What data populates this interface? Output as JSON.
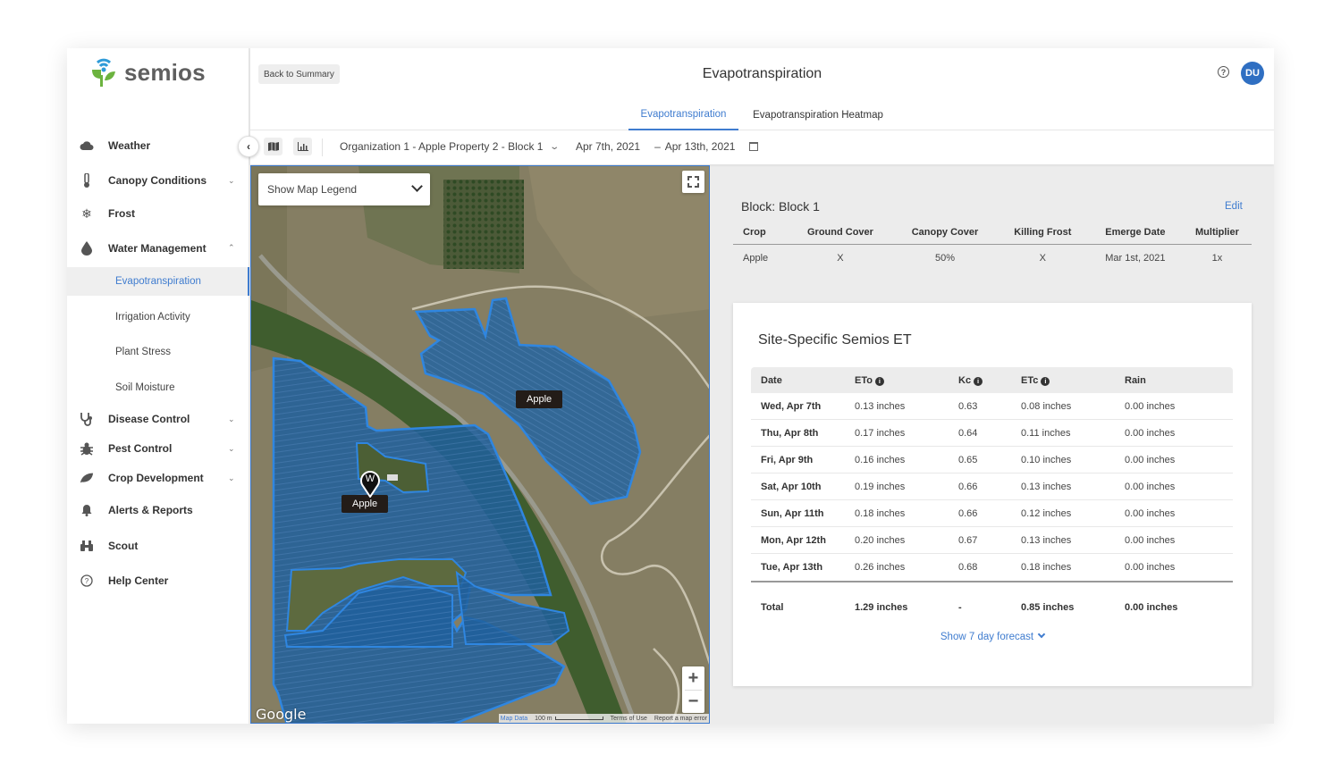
{
  "app": {
    "brand": "semios",
    "title": "Evapotranspiration",
    "back_label": "Back to Summary",
    "user_initials": "DU",
    "accent_color": "#3f7ccf"
  },
  "sidebar": {
    "items": [
      {
        "label": "Weather",
        "icon": "cloud-icon"
      },
      {
        "label": "Canopy Conditions",
        "icon": "thermometer-icon",
        "expandable": true
      },
      {
        "label": "Frost",
        "icon": "snowflake-icon"
      },
      {
        "label": "Water Management",
        "icon": "water-drop-icon",
        "expanded": true
      },
      {
        "label": "Disease Control",
        "icon": "stethoscope-icon",
        "expandable": true
      },
      {
        "label": "Pest Control",
        "icon": "bug-icon",
        "expandable": true
      },
      {
        "label": "Crop Development",
        "icon": "leaf-icon",
        "expandable": true
      },
      {
        "label": "Alerts & Reports",
        "icon": "bell-icon"
      },
      {
        "label": "Scout",
        "icon": "binoculars-icon"
      },
      {
        "label": "Help Center",
        "icon": "help-circle-icon"
      }
    ],
    "water_subitems": [
      {
        "label": "Evapotranspiration",
        "active": true
      },
      {
        "label": "Irrigation Activity"
      },
      {
        "label": "Plant Stress"
      },
      {
        "label": "Soil Moisture"
      }
    ]
  },
  "tabs": [
    {
      "label": "Evapotranspiration",
      "active": true
    },
    {
      "label": "Evapotranspiration Heatmap"
    }
  ],
  "toolbar": {
    "location": "Organization 1 - Apple Property 2 - Block 1",
    "date_start": "Apr 7th, 2021",
    "date_separator": "–",
    "date_end": "Apr 13th, 2021"
  },
  "map": {
    "legend_label": "Show Map Legend",
    "block_labels": [
      "Apple",
      "Apple"
    ],
    "pin_letter": "W",
    "attribution": {
      "logo": "Google",
      "map_data": "Map Data",
      "scale": "100 m",
      "terms": "Terms of Use",
      "report": "Report a map error"
    }
  },
  "block": {
    "title": "Block: Block 1",
    "edit_label": "Edit",
    "columns": [
      "Crop",
      "Ground Cover",
      "Canopy Cover",
      "Killing Frost",
      "Emerge Date",
      "Multiplier"
    ],
    "row": [
      "Apple",
      "X",
      "50%",
      "X",
      "Mar 1st, 2021",
      "1x"
    ]
  },
  "et": {
    "title": "Site-Specific Semios ET",
    "columns": [
      "Date",
      "ETo",
      "Kc",
      "ETc",
      "Rain"
    ],
    "rows": [
      [
        "Wed, Apr 7th",
        "0.13 inches",
        "0.63",
        "0.08 inches",
        "0.00 inches"
      ],
      [
        "Thu, Apr 8th",
        "0.17 inches",
        "0.64",
        "0.11 inches",
        "0.00 inches"
      ],
      [
        "Fri, Apr 9th",
        "0.16 inches",
        "0.65",
        "0.10 inches",
        "0.00 inches"
      ],
      [
        "Sat, Apr 10th",
        "0.19 inches",
        "0.66",
        "0.13 inches",
        "0.00 inches"
      ],
      [
        "Sun, Apr 11th",
        "0.18 inches",
        "0.66",
        "0.12 inches",
        "0.00 inches"
      ],
      [
        "Mon, Apr 12th",
        "0.20 inches",
        "0.67",
        "0.13 inches",
        "0.00 inches"
      ],
      [
        "Tue, Apr 13th",
        "0.26 inches",
        "0.68",
        "0.18 inches",
        "0.00 inches"
      ]
    ],
    "total": [
      "Total",
      "1.29 inches",
      "-",
      "0.85 inches",
      "0.00 inches"
    ],
    "forecast_label": "Show 7 day forecast"
  }
}
